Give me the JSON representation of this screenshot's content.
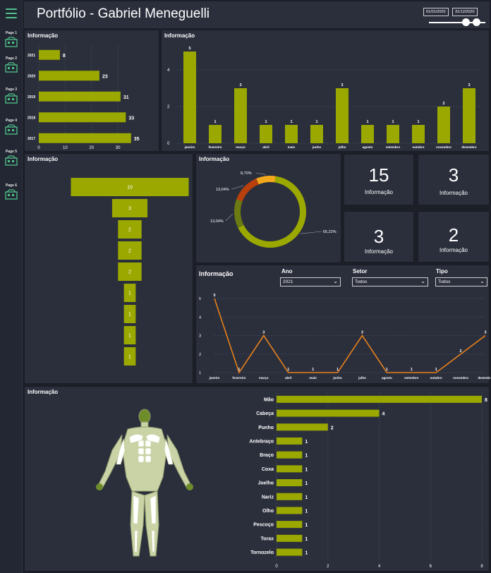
{
  "header": {
    "title": "Portfólio - Gabriel Meneguelli",
    "date_start": "01/01/2020",
    "date_end": "31/12/2020"
  },
  "nav": [
    {
      "label": "Page 1",
      "icon": "factory-icon"
    },
    {
      "label": "Page 2",
      "icon": "truck-icon"
    },
    {
      "label": "Page 3",
      "icon": "monitor-icon"
    },
    {
      "label": "Page 4",
      "icon": "boxes-icon"
    },
    {
      "label": "Page 5",
      "icon": "building-icon"
    },
    {
      "label": "Page 6",
      "icon": "network-icon"
    }
  ],
  "colors": {
    "bar": "#9aa800",
    "line": "#e8801a",
    "panel": "#2b2f3c",
    "donut_dark": "#6b7a12",
    "donut_red": "#b8400c",
    "donut_orange": "#f3a81b"
  },
  "year_chart": {
    "title": "Informação"
  },
  "month_chart": {
    "title": "Informação"
  },
  "funnel": {
    "title": "Informação"
  },
  "donut": {
    "title": "Informação"
  },
  "cards": [
    {
      "value": "15",
      "caption": "Informação"
    },
    {
      "value": "3",
      "caption": "Informação"
    },
    {
      "value": "3",
      "caption": "Informação"
    },
    {
      "value": "2",
      "caption": "Informação"
    }
  ],
  "line_panel": {
    "title": "Informação",
    "filters": [
      {
        "label": "Ano",
        "value": "2021"
      },
      {
        "label": "Setor",
        "value": "Todos"
      },
      {
        "label": "Tipo",
        "value": "Todos"
      }
    ]
  },
  "body_chart": {
    "title": "Informação"
  },
  "chart_data": [
    {
      "type": "bar",
      "orientation": "horizontal",
      "categories": [
        "2021",
        "2020",
        "2019",
        "2018",
        "2017"
      ],
      "values": [
        8,
        23,
        31,
        33,
        35
      ],
      "xticks": [
        0,
        10,
        20,
        30
      ],
      "xlim": [
        0,
        38
      ]
    },
    {
      "type": "bar",
      "categories": [
        "janeiro",
        "fevereiro",
        "março",
        "abril",
        "maio",
        "junho",
        "julho",
        "agosto",
        "setembro",
        "outubro",
        "novembro",
        "dezembro"
      ],
      "values": [
        5,
        1,
        3,
        1,
        1,
        1,
        3,
        1,
        1,
        1,
        2,
        3
      ],
      "yticks": [
        0,
        2,
        4
      ],
      "ylim": [
        0,
        5
      ]
    },
    {
      "type": "bar",
      "subtype": "funnel",
      "values": [
        10,
        3,
        2,
        2,
        2,
        1,
        1,
        1,
        1
      ]
    },
    {
      "type": "pie",
      "subtype": "donut",
      "slices": [
        {
          "value": 65.22,
          "label": "65,22%"
        },
        {
          "value": 13.04,
          "label": "13,04%"
        },
        {
          "value": 13.04,
          "label": "13,04%"
        },
        {
          "value": 8.7,
          "label": "8,70%"
        }
      ]
    },
    {
      "type": "line",
      "categories": [
        "janeiro",
        "fevereiro",
        "março",
        "abril",
        "maio",
        "junho",
        "julho",
        "agosto",
        "setembro",
        "outubro",
        "novembro",
        "dezembro"
      ],
      "values": [
        5,
        1,
        3,
        1,
        1,
        1,
        3,
        1,
        1,
        1,
        2,
        3
      ],
      "yticks": [
        1,
        2,
        3,
        4,
        5
      ],
      "ylim": [
        1,
        5
      ]
    },
    {
      "type": "bar",
      "orientation": "horizontal",
      "categories": [
        "Mão",
        "Cabeça",
        "Punho",
        "Antebraço",
        "Braço",
        "Coxa",
        "Joelho",
        "Nariz",
        "Olho",
        "Pescoço",
        "Torax",
        "Tornozelo"
      ],
      "values": [
        8,
        4,
        2,
        1,
        1,
        1,
        1,
        1,
        1,
        1,
        1,
        1
      ],
      "xticks": [
        0,
        2,
        4,
        6,
        8
      ],
      "xlim": [
        0,
        8
      ]
    }
  ]
}
